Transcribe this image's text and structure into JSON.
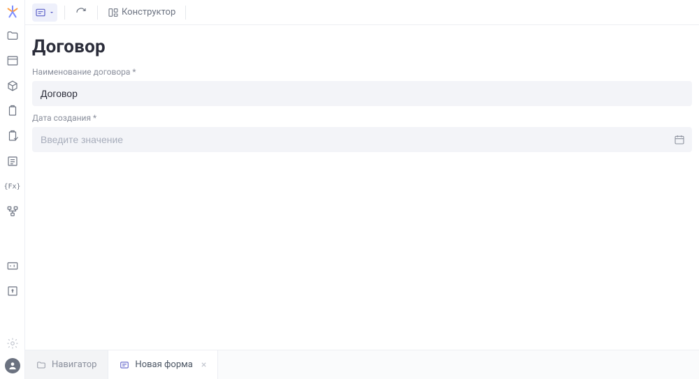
{
  "toolbar": {
    "constructor_label": "Конструктор"
  },
  "page": {
    "title": "Договор"
  },
  "fields": {
    "name": {
      "label": "Наименование договора *",
      "value": "Договор"
    },
    "date": {
      "label": "Дата создания *",
      "placeholder": "Введите значение",
      "value": ""
    }
  },
  "tabs": {
    "navigator": "Навигатор",
    "new_form": "Новая форма"
  }
}
